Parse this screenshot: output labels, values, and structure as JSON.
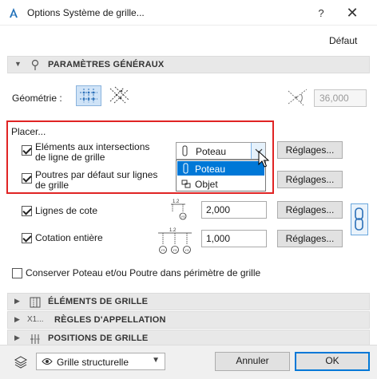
{
  "window": {
    "title": "Options Système de grille...",
    "help": "?",
    "close": "✕"
  },
  "header": {
    "defaut": "Défaut"
  },
  "sections": {
    "general": "PARAMÈTRES GÉNÉRAUX",
    "grid_elements": "ÉLÉMENTS DE GRILLE",
    "naming_rules": "RÈGLES D'APPELLATION",
    "grid_positions": "POSITIONS DE GRILLE",
    "naming_prefix": "X1..."
  },
  "geometry": {
    "label": "Géométrie :",
    "angle_value": "36,000"
  },
  "placer": {
    "label": "Placer...",
    "intersections": {
      "label_line1": "Eléments aux intersections",
      "label_line2": "de ligne de grille",
      "checked": true
    },
    "beams": {
      "label_line1": "Poutres par défaut sur lignes",
      "label_line2": "de grille",
      "checked": true
    },
    "select": {
      "value": "Poteau",
      "options": [
        "Poteau",
        "Objet"
      ],
      "selected_index": 0
    }
  },
  "dimension_lines": {
    "label": "Lignes de cote",
    "checked": true,
    "value": "2,000",
    "icon_value": "1.2"
  },
  "full_dimension": {
    "label": "Cotation entière",
    "checked": true,
    "value": "1,000",
    "icon_value": "1.2"
  },
  "buttons": {
    "reglages": "Réglages...",
    "cancel": "Annuler",
    "ok": "OK"
  },
  "keep_option": {
    "label": "Conserver Poteau et/ou Poutre dans périmètre de grille",
    "checked": false
  },
  "footer": {
    "layer": "Grille structurelle"
  },
  "colors": {
    "highlight_frame": "#e02424",
    "selection": "#0078d7"
  }
}
